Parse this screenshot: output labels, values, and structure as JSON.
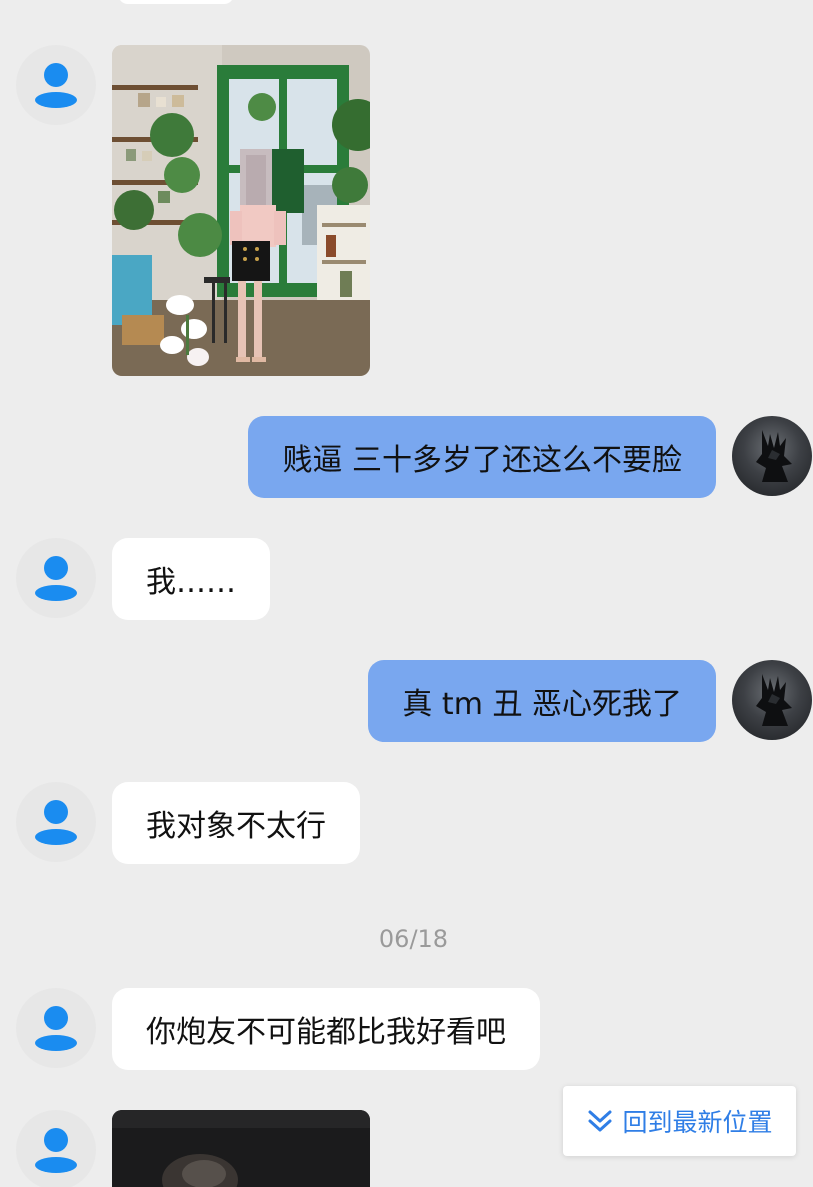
{
  "colors": {
    "background": "#ededed",
    "incoming_bubble": "#ffffff",
    "outgoing_bubble": "#79a7ef",
    "default_avatar_icon": "#1a8cf0",
    "link_blue": "#2f7ee6",
    "timestamp_gray": "#9a9a9a"
  },
  "messages": [
    {
      "side": "incoming",
      "type": "image",
      "avatar_icon": "person-icon",
      "image": "photo-woman-in-plant-room"
    },
    {
      "side": "outgoing",
      "type": "text",
      "text": "贱逼 三十多岁了还这么不要脸",
      "avatar_icon": "dark-figure-avatar"
    },
    {
      "side": "incoming",
      "type": "text",
      "text": "我……",
      "avatar_icon": "person-icon"
    },
    {
      "side": "outgoing",
      "type": "text",
      "text": "真 tm 丑 恶心死我了",
      "avatar_icon": "dark-figure-avatar"
    },
    {
      "side": "incoming",
      "type": "text",
      "text": "我对象不太行",
      "avatar_icon": "person-icon"
    },
    {
      "side": "divider",
      "type": "timestamp",
      "text": "06/18"
    },
    {
      "side": "incoming",
      "type": "text",
      "text": "你炮友不可能都比我好看吧",
      "avatar_icon": "person-icon"
    },
    {
      "side": "incoming",
      "type": "image",
      "avatar_icon": "person-icon",
      "image": "photo-dark-partial"
    }
  ],
  "jump_button": {
    "label": "回到最新位置",
    "icon": "double-chevron-down-icon"
  }
}
